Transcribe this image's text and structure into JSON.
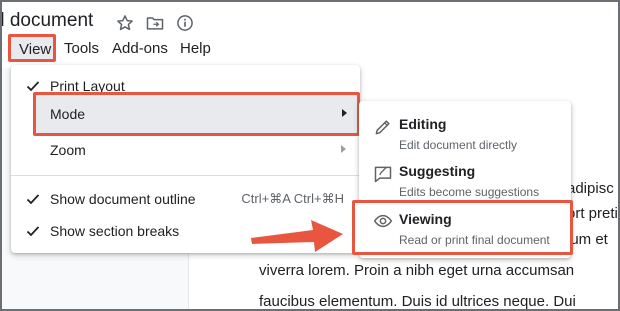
{
  "document": {
    "title": "d document",
    "body_lines": [
      "adipisc",
      "ort pretiu",
      "lum et",
      "viverra lorem. Proin a nibh eget urna accumsan",
      "faucibus elementum. Duis id ultrices neque. Dui"
    ]
  },
  "title_icons": [
    "star-icon",
    "folder-move-icon",
    "info-icon"
  ],
  "menubar": {
    "items": [
      {
        "label": "View"
      },
      {
        "label": "Tools"
      },
      {
        "label": "Add-ons"
      },
      {
        "label": "Help"
      }
    ]
  },
  "view_menu": {
    "items": [
      {
        "label": "Print Layout",
        "checked": true
      },
      {
        "label": "Mode",
        "submenu": true
      },
      {
        "label": "Zoom",
        "submenu": true
      },
      {
        "label": "Show document outline",
        "checked": true,
        "shortcut": "Ctrl+⌘A Ctrl+⌘H"
      },
      {
        "label": "Show section breaks",
        "checked": true
      }
    ]
  },
  "mode_submenu": {
    "items": [
      {
        "title": "Editing",
        "description": "Edit document directly",
        "icon": "pencil-icon"
      },
      {
        "title": "Suggesting",
        "description": "Edits become suggestions",
        "icon": "suggest-icon"
      },
      {
        "title": "Viewing",
        "description": "Read or print final document",
        "icon": "eye-icon"
      }
    ]
  },
  "colors": {
    "highlight_border": "#e8563f",
    "menu_hover": "#e8eaed",
    "text": "#202124",
    "secondary_text": "#5f6368"
  }
}
